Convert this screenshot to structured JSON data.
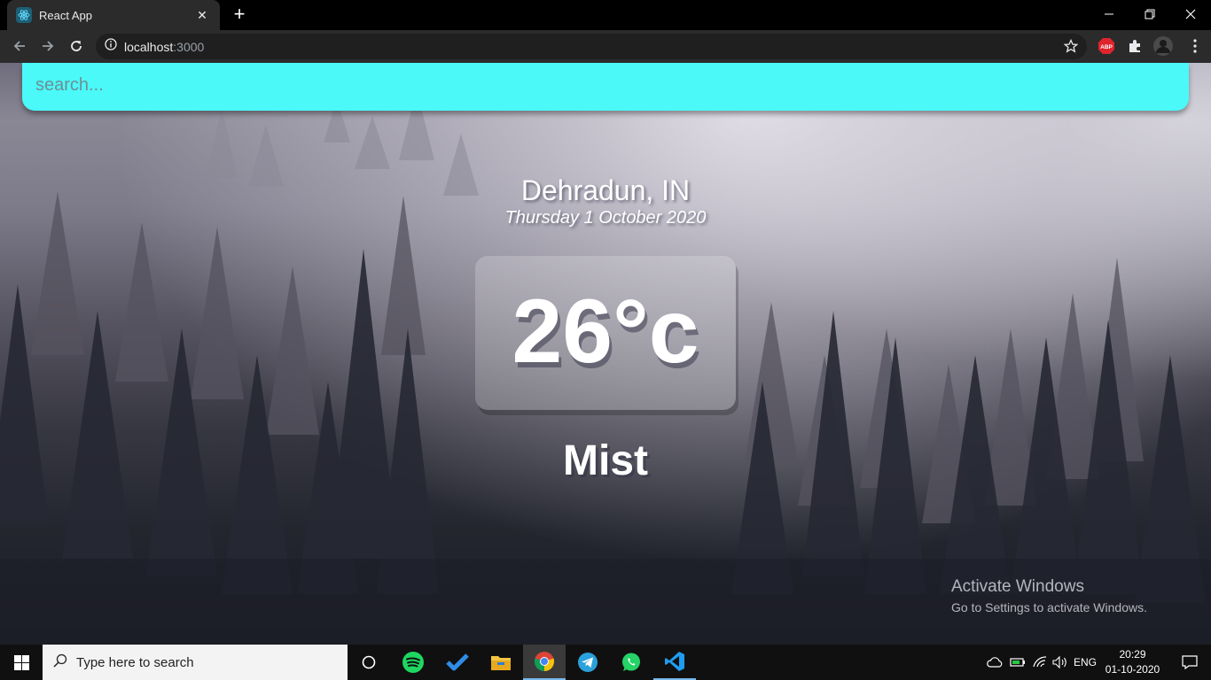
{
  "browser": {
    "tab_title": "React App",
    "tab_close": "✕",
    "new_tab": "+",
    "url_host": "localhost",
    "url_port": ":3000",
    "ext_badge": "ABP"
  },
  "page": {
    "search_placeholder": "search...",
    "search_value": "",
    "location": "Dehradun, IN",
    "date": "Thursday 1 October 2020",
    "temperature": "26°c",
    "weather": "Mist",
    "search_bar_color": "#4bf9f9"
  },
  "watermark": {
    "title": "Activate Windows",
    "subtitle": "Go to Settings to activate Windows."
  },
  "taskbar": {
    "search_text": "Type here to search",
    "pinned_apps": [
      "cortana-icon",
      "spotify-icon",
      "todo-icon",
      "file-explorer-icon",
      "chrome-icon",
      "telegram-icon",
      "whatsapp-icon",
      "vscode-icon"
    ],
    "language": "ENG",
    "time": "20:29",
    "date": "01-10-2020"
  }
}
